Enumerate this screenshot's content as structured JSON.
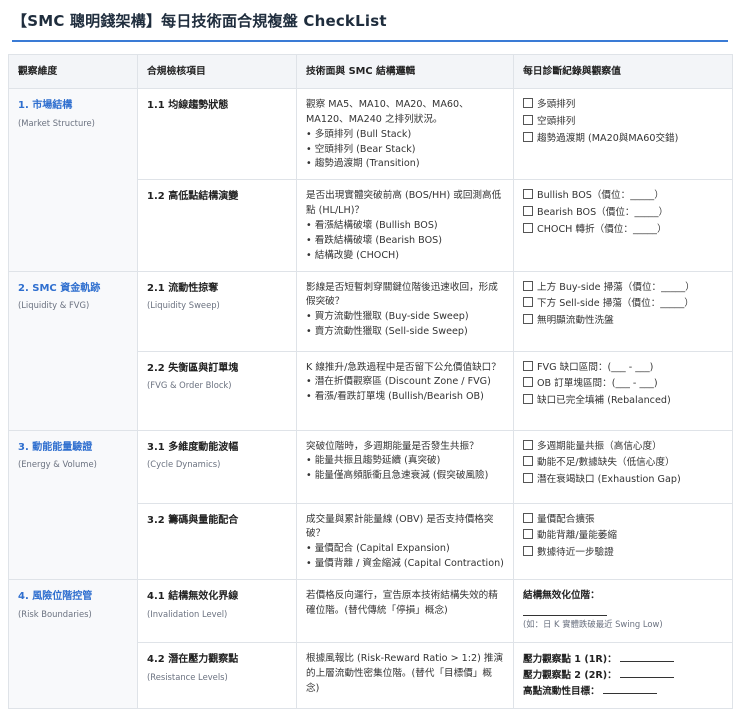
{
  "title": "【SMC 聰明錢架構】每日技術面合規複盤 CheckList",
  "headers": [
    "觀察維度",
    "合規檢核項目",
    "技術面與 SMC 結構邏輯",
    "每日診斷紀錄與觀察值"
  ],
  "sections": [
    {
      "dimension": "1. 市場結構",
      "dimension_en": "(Market Structure)",
      "items": [
        {
          "title": "1.1 均線趨勢狀態",
          "subtitle": "",
          "logic_intro": "觀察 MA5、MA10、MA20、MA60、MA120、MA240 之排列狀況。",
          "logic_bullets": [
            "• 多頭排列 (Bull Stack)",
            "• 空頭排列 (Bear Stack)",
            "• 趨勢過渡期 (Transition)"
          ],
          "checks": [
            "多頭排列",
            "空頭排列",
            "趨勢過渡期 (MA20與MA60交錯)"
          ]
        },
        {
          "title": "1.2 高低點結構演變",
          "subtitle": "",
          "logic_intro": "是否出現實體突破前高 (BOS/HH) 或回測高低點 (HL/LH)？",
          "logic_bullets": [
            "• 看漲結構破壞 (Bullish BOS)",
            "• 看跌結構破壞 (Bearish BOS)",
            "• 結構改變 (CHOCH)"
          ],
          "checks": [
            "Bullish BOS（價位：_____）",
            "Bearish BOS（價位：_____）",
            "CHOCH 轉折（價位：_____）"
          ]
        }
      ]
    },
    {
      "dimension": "2. SMC 資金軌跡",
      "dimension_en": "(Liquidity & FVG)",
      "items": [
        {
          "title": "2.1 流動性掠奪",
          "subtitle": "(Liquidity Sweep)",
          "logic_intro": "影線是否短暫刺穿關鍵位階後迅速收回，形成假突破？",
          "logic_bullets": [
            "• 買方流動性獵取 (Buy-side Sweep)",
            "• 賣方流動性獵取 (Sell-side Sweep)"
          ],
          "checks": [
            "上方 Buy-side 掃蕩（價位：_____）",
            "下方 Sell-side 掃蕩（價位：_____）",
            "無明顯流動性洗盤"
          ]
        },
        {
          "title": "2.2 失衡區與訂單塊",
          "subtitle": "(FVG & Order Block)",
          "logic_intro": "K 線推升/急跌過程中是否留下公允價值缺口？",
          "logic_bullets": [
            "• 潛在折價觀察區 (Discount Zone / FVG)",
            "• 看漲/看跌訂單塊 (Bullish/Bearish OB)"
          ],
          "checks": [
            "FVG 缺口區間：(___ - ___)",
            "OB 訂單塊區間：(___ - ___)",
            "缺口已完全填補 (Rebalanced)"
          ]
        }
      ]
    },
    {
      "dimension": "3. 動能能量驗證",
      "dimension_en": "(Energy & Volume)",
      "items": [
        {
          "title": "3.1 多維度動能波幅",
          "subtitle": "(Cycle Dynamics)",
          "logic_intro": "突破位階時，多週期能量是否發生共振？",
          "logic_bullets": [
            "• 能量共振且趨勢延續 (真突破)",
            "• 能量僅高頻脈衝且急速衰減 (假突破風險)"
          ],
          "checks": [
            "多週期能量共振（高信心度）",
            "動能不足/數據缺失（低信心度）",
            "潛在衰竭缺口 (Exhaustion Gap)"
          ]
        },
        {
          "title": "3.2 籌碼與量能配合",
          "subtitle": "",
          "logic_intro": "成交量與累計能量線 (OBV) 是否支持價格突破？",
          "logic_bullets": [
            "• 量價配合 (Capital Expansion)",
            "• 量價背離 / 資金縮減 (Capital Contraction)"
          ],
          "checks": [
            "量價配合擴張",
            "動能背離/量能萎縮",
            "數據待近一步驗證"
          ]
        }
      ]
    },
    {
      "dimension": "4. 風險位階控管",
      "dimension_en": "(Risk Boundaries)",
      "items": [
        {
          "title": "4.1 結構無效化界線",
          "subtitle": "(Invalidation Level)",
          "logic_intro": "若價格反向運行，宣告原本技術結構失效的精確位階。(替代傳統「停損」概念)",
          "logic_bullets": [],
          "obs_label": "結構無效化位階：",
          "obs_note": "(如：日 K 實體跌破最近 Swing Low)"
        },
        {
          "title": "4.2 潛在壓力觀察點",
          "subtitle": "(Resistance Levels)",
          "logic_intro": "根據風報比 (Risk-Reward Ratio > 1:2) 推演的上層流動性密集位階。(替代「目標價」概念)",
          "logic_bullets": [],
          "obs_lines": [
            "壓力觀察點 1 (1R)：",
            "壓力觀察點 2 (2R)：",
            "高點流動性目標："
          ]
        }
      ]
    }
  ]
}
